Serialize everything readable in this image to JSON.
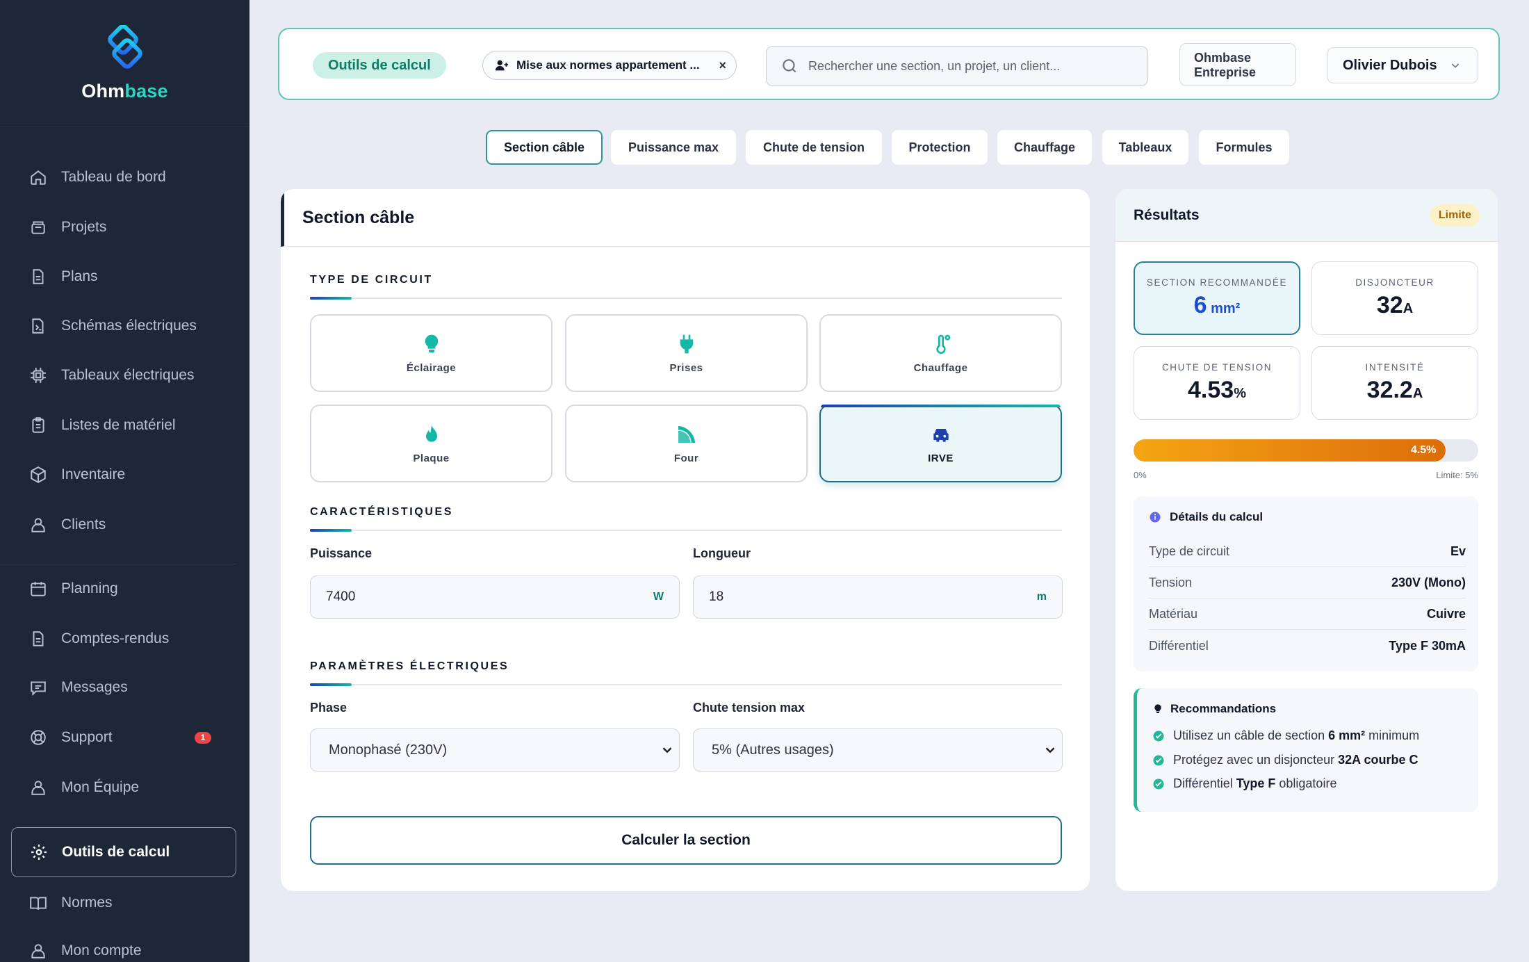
{
  "brand": {
    "name_main": "Ohm",
    "name_accent": "base"
  },
  "sidebar": {
    "items": [
      {
        "label": "Tableau de bord",
        "icon": "home-icon"
      },
      {
        "label": "Projets",
        "icon": "folder-icon"
      },
      {
        "label": "Plans",
        "icon": "document-icon"
      },
      {
        "label": "Schémas électriques",
        "icon": "schema-icon"
      },
      {
        "label": "Tableaux électriques",
        "icon": "cpu-icon"
      },
      {
        "label": "Listes de matériel",
        "icon": "clipboard-icon"
      },
      {
        "label": "Inventaire",
        "icon": "box-icon"
      },
      {
        "label": "Clients",
        "icon": "users-icon"
      },
      {
        "label": "Planning",
        "icon": "calendar-icon"
      },
      {
        "label": "Comptes-rendus",
        "icon": "report-icon"
      },
      {
        "label": "Messages",
        "icon": "chat-icon"
      },
      {
        "label": "Support",
        "icon": "lifebuoy-icon",
        "badge": "1"
      },
      {
        "label": "Mon Équipe",
        "icon": "team-icon"
      },
      {
        "label": "Outils de calcul",
        "icon": "gear-icon",
        "active": true
      },
      {
        "label": "Normes",
        "icon": "book-icon"
      },
      {
        "label": "Mon compte",
        "icon": "user-icon"
      }
    ]
  },
  "topbar": {
    "tool_chip": "Outils de calcul",
    "project_chip": "Mise aux normes appartement ...",
    "project_close": "×",
    "search_placeholder": "Rechercher une section, un projet, un client...",
    "company_line1": "Ohmbase",
    "company_line2": "Entreprise",
    "user_name": "Olivier Dubois"
  },
  "tabs": [
    {
      "label": "Section câble",
      "active": true
    },
    {
      "label": "Puissance max"
    },
    {
      "label": "Chute de tension"
    },
    {
      "label": "Protection"
    },
    {
      "label": "Chauffage"
    },
    {
      "label": "Tableaux"
    },
    {
      "label": "Formules"
    }
  ],
  "form": {
    "title": "Section câble",
    "circuit_type_title": "TYPE DE CIRCUIT",
    "circuit_types": [
      {
        "label": "Éclairage",
        "icon": "bulb-icon"
      },
      {
        "label": "Prises",
        "icon": "plug-icon"
      },
      {
        "label": "Chauffage",
        "icon": "thermometer-icon"
      },
      {
        "label": "Plaque",
        "icon": "flame-icon"
      },
      {
        "label": "Four",
        "icon": "pizza-icon"
      },
      {
        "label": "IRVE",
        "icon": "car-icon",
        "active": true
      }
    ],
    "characteristics_title": "CARACTÉRISTIQUES",
    "power_label": "Puissance",
    "power_value": "7400",
    "power_unit": "W",
    "length_label": "Longueur",
    "length_value": "18",
    "length_unit": "m",
    "electrical_title": "PARAMÈTRES ÉLECTRIQUES",
    "phase_label": "Phase",
    "phase_value": "Monophasé (230V)",
    "drop_label": "Chute tension max",
    "drop_value": "5% (Autres usages)",
    "submit": "Calculer la section"
  },
  "results": {
    "title": "Résultats",
    "status": "Limite",
    "cards": [
      {
        "label": "SECTION RECOMMANDÉE",
        "value": "6",
        "unit": " mm²"
      },
      {
        "label": "DISJONCTEUR",
        "value": "32",
        "unit": "A"
      },
      {
        "label": "CHUTE DE TENSION",
        "value": "4.53",
        "unit": "%"
      },
      {
        "label": "INTENSITÉ",
        "value": "32.2",
        "unit": "A"
      }
    ],
    "bar": {
      "value_label": "4.5%",
      "percent_of_limit": 90.6,
      "min_label": "0%",
      "max_label": "Limite: 5%"
    },
    "details_title": "Détails du calcul",
    "details": [
      {
        "k": "Type de circuit",
        "v": "Ev"
      },
      {
        "k": "Tension",
        "v": "230V (Mono)"
      },
      {
        "k": "Matériau",
        "v": "Cuivre"
      },
      {
        "k": "Différentiel",
        "v": "Type F 30mA"
      }
    ],
    "reco_title": "Recommandations",
    "reco": [
      {
        "pre": "Utilisez un câble de section ",
        "bold": "6 mm²",
        "post": " minimum"
      },
      {
        "pre": "Protégez avec un disjoncteur ",
        "bold": "32A courbe C",
        "post": ""
      },
      {
        "pre": "Différentiel ",
        "bold": "Type F",
        "post": " obligatoire"
      }
    ]
  },
  "colors": {
    "sidebar_bg": "#1d2738",
    "accent": "#14b8a6",
    "primary": "#1d4ed8",
    "warning": "#f59e0b"
  }
}
